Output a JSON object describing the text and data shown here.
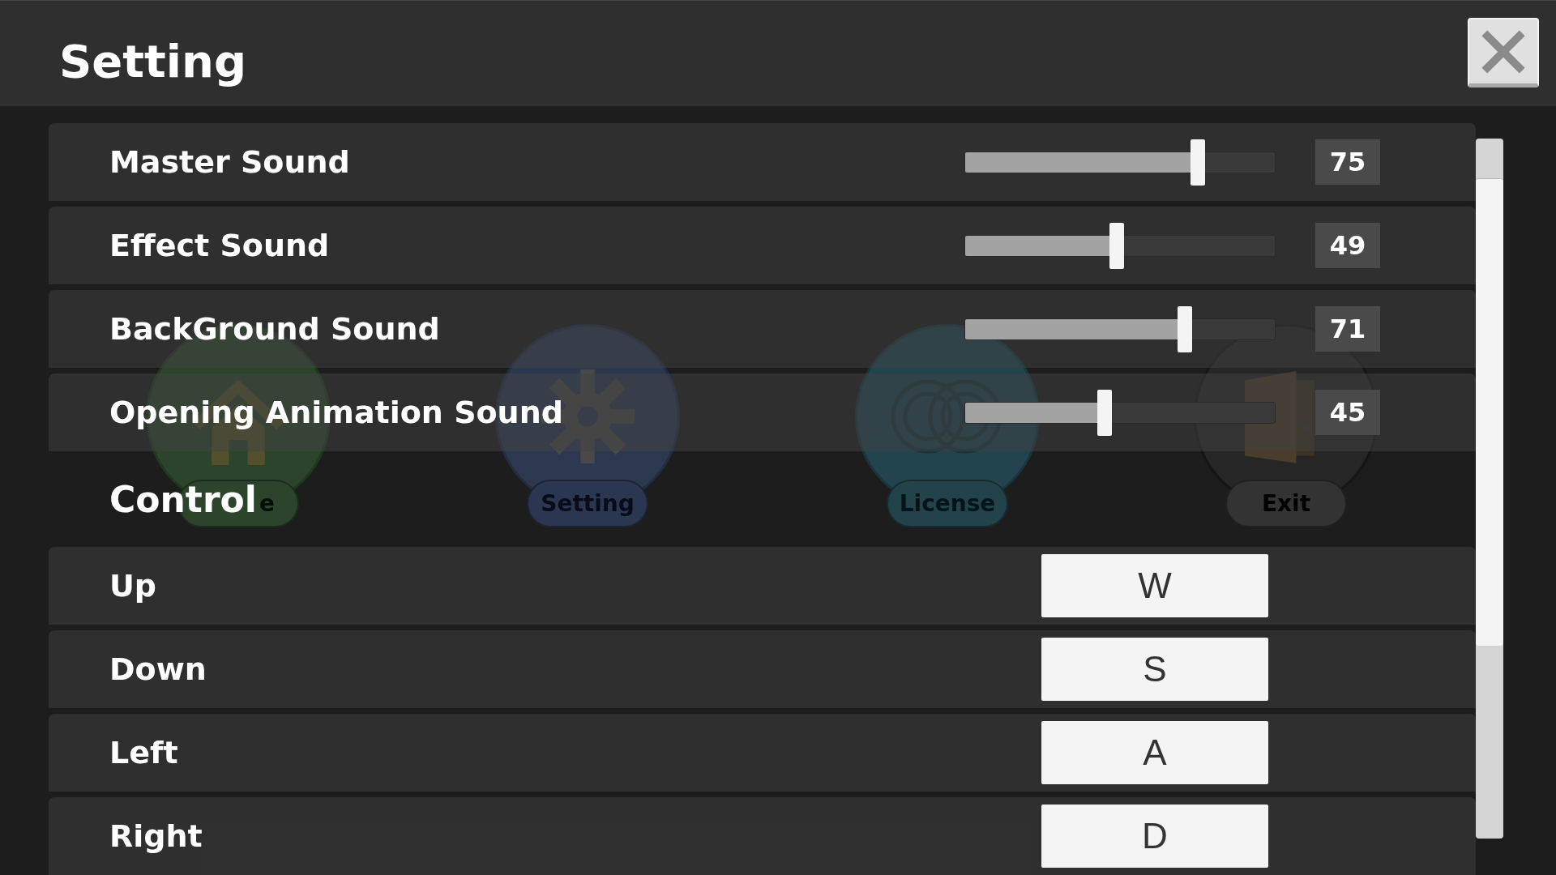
{
  "background_menu": [
    {
      "kind": "home",
      "label": "e"
    },
    {
      "kind": "setting",
      "label": "Setting"
    },
    {
      "kind": "license",
      "label": "License"
    },
    {
      "kind": "exit",
      "label": "Exit"
    }
  ],
  "dialog": {
    "title": "Setting",
    "sound_settings": [
      {
        "label": "Master Sound",
        "level": 0.75,
        "reading": "75"
      },
      {
        "label": "Effect Sound",
        "level": 0.49,
        "reading": "49"
      },
      {
        "label": "BackGround Sound",
        "level": 0.71,
        "reading": "71"
      },
      {
        "label": "Opening Animation Sound",
        "level": 0.45,
        "reading": "45"
      }
    ],
    "control_section": {
      "title": "Control"
    },
    "key_bindings": [
      {
        "action": "Up",
        "key": "W"
      },
      {
        "action": "Down",
        "key": "S"
      },
      {
        "action": "Left",
        "key": "A"
      },
      {
        "action": "Right",
        "key": "D"
      }
    ]
  }
}
